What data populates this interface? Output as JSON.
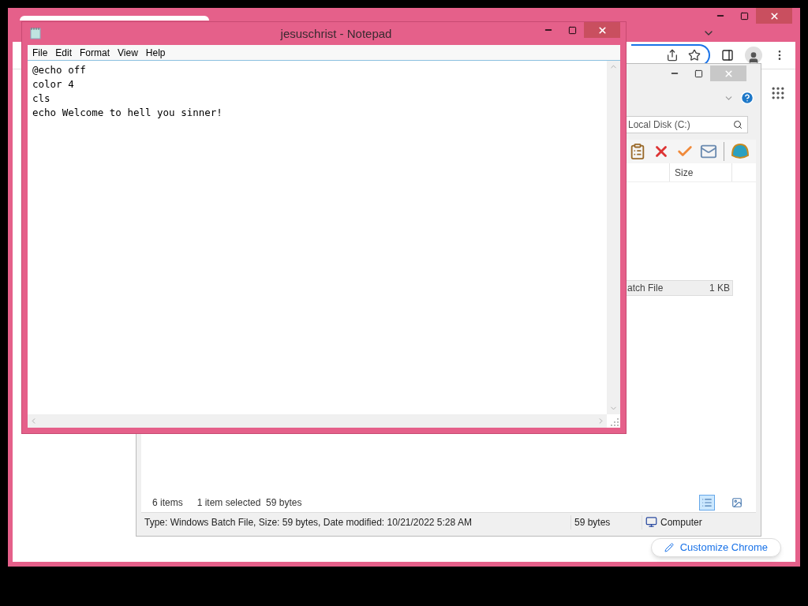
{
  "chrome": {
    "customize_button": "Customize Chrome"
  },
  "explorer": {
    "search": {
      "placeholder": "Local Disk (C:)"
    },
    "columns": [
      "Size"
    ],
    "rows": [
      {
        "type": "atch File",
        "size": "1 KB",
        "selected": true
      }
    ],
    "item_count": "6 items",
    "selection_info": "1 item selected  59 bytes",
    "views": [
      {
        "kind": "details",
        "selected": true
      },
      {
        "kind": "preview",
        "selected": false
      }
    ],
    "status_bar": {
      "details": "Type: Windows Batch File, Size: 59 bytes, Date modified: 10/21/2022 5:28 AM",
      "size": "59 bytes",
      "zone": "Computer"
    }
  },
  "notepad": {
    "title": "jesuschrist - Notepad",
    "menu": [
      "File",
      "Edit",
      "Format",
      "View",
      "Help"
    ],
    "lines": [
      "@echo off",
      "color 4",
      "cls",
      "echo Welcome to hell you sinner!"
    ]
  }
}
